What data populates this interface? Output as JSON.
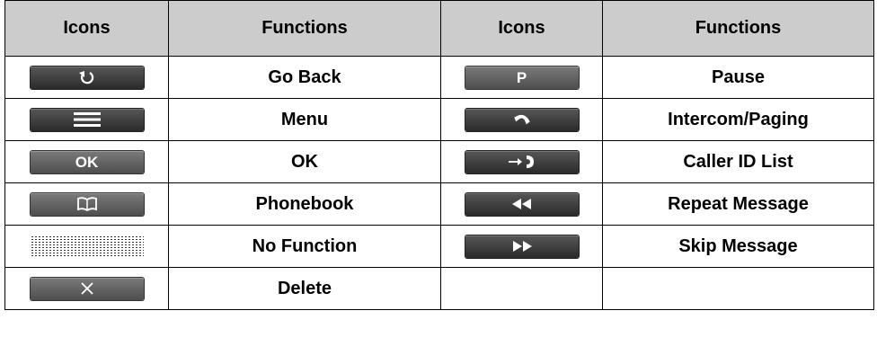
{
  "headers": [
    "Icons",
    "Functions",
    "Icons",
    "Functions"
  ],
  "rows": [
    {
      "left_icon": "go-back-icon",
      "left_function": "Go Back",
      "right_icon": "pause-key-icon",
      "right_key_text": "P",
      "right_function": "Pause"
    },
    {
      "left_icon": "menu-icon",
      "left_function": "Menu",
      "right_icon": "handset-icon",
      "right_function": "Intercom/Paging"
    },
    {
      "left_icon": "ok-key-icon",
      "left_key_text": "OK",
      "left_function": "OK",
      "right_icon": "caller-id-icon",
      "right_function": "Caller ID List"
    },
    {
      "left_icon": "phonebook-icon",
      "left_function": "Phonebook",
      "right_icon": "rewind-icon",
      "right_function": "Repeat Message"
    },
    {
      "left_icon": "no-function-icon",
      "left_function": "No Function",
      "right_icon": "fast-forward-icon",
      "right_function": "Skip Message"
    },
    {
      "left_icon": "delete-icon",
      "left_function": "Delete",
      "right_icon": "",
      "right_function": ""
    }
  ]
}
